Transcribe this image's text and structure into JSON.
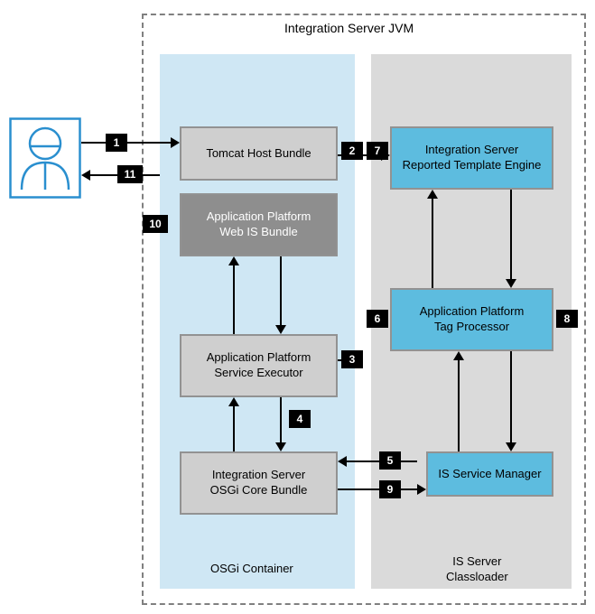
{
  "title": "Integration Server JVM",
  "containers": {
    "osgi": "OSGi Container",
    "iscl": "IS Server\nClassloader"
  },
  "nodes": {
    "tomcat": "Tomcat Host Bundle",
    "webis": "Application Platform\nWeb IS Bundle",
    "svcExec": "Application Platform\nService Executor",
    "osgiCore": "Integration Server\nOSGi Core Bundle",
    "rte": "Integration Server\nReported Template Engine",
    "tagProc": "Application Platform\nTag Processor",
    "isMgr": "IS Service Manager"
  },
  "steps": {
    "s1": "1",
    "s2": "2",
    "s3": "3",
    "s4": "4",
    "s5": "5",
    "s6": "6",
    "s7": "7",
    "s8": "8",
    "s9": "9",
    "s10": "10",
    "s11": "11"
  }
}
